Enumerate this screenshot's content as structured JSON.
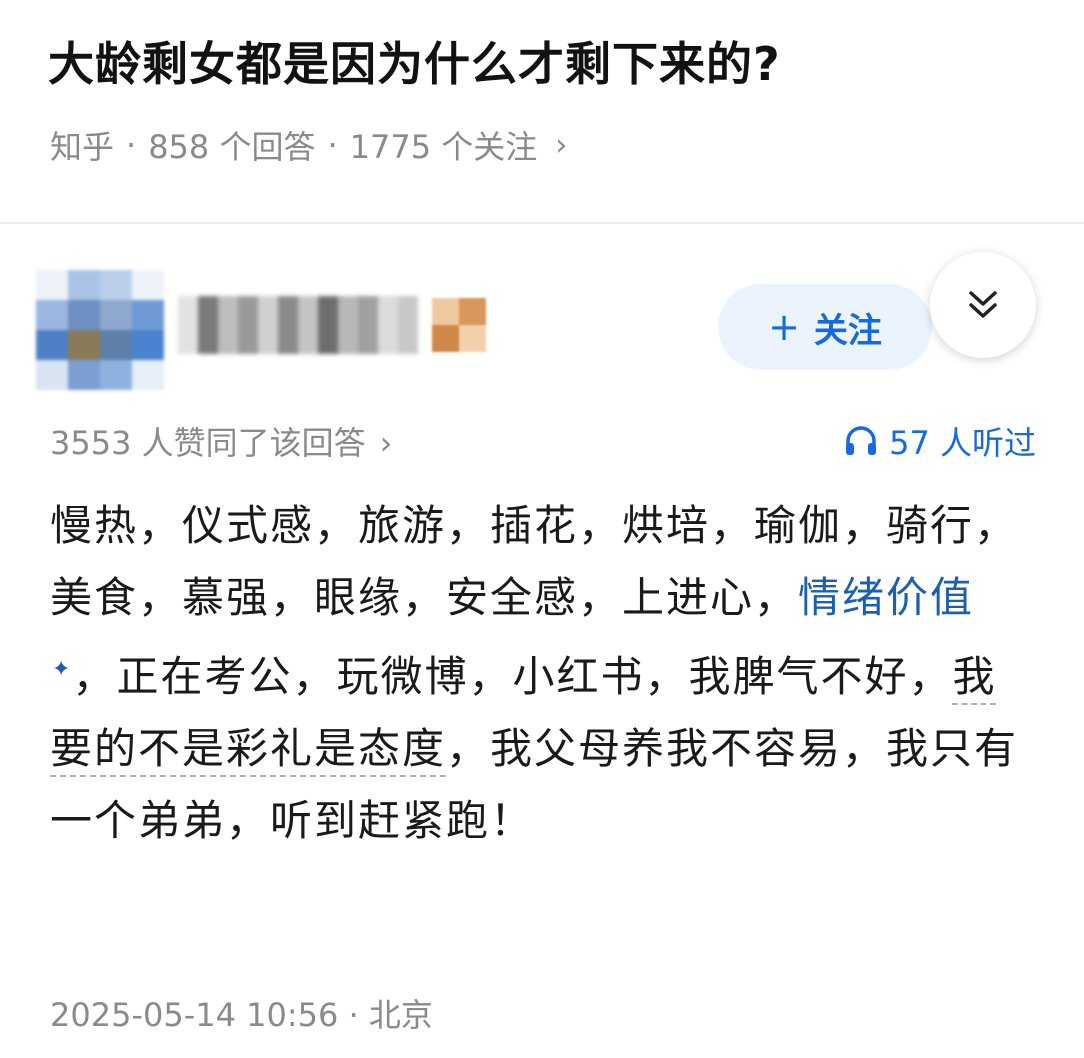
{
  "question": {
    "title": "大龄剩女都是因为什么才剩下来的?",
    "source": "知乎",
    "answers": "858 个回答",
    "followers": "1775 个关注",
    "separator": "·",
    "chevron": "›"
  },
  "author": {
    "follow_label": "关注",
    "follow_plus": "+",
    "collapse_icon": "double-chevron-down-icon"
  },
  "stats": {
    "upvote_text": "3553 人赞同了该回答",
    "upvote_chevron": "›",
    "listen_text": "57 人听过",
    "listen_icon": "headphones-icon"
  },
  "answer": {
    "part1": "慢热，仪式感，旅游，插花，烘培，瑜伽，骑行，美食，慕强，眼缘，安全感，上进心，",
    "link_text": "情绪价值",
    "link_mark": "✦",
    "part2": "，正在考公，玩微博，小红书，我脾气不好，",
    "underlined": "我要的不是彩礼是态度",
    "part3": "，我父母养我不容易，我只有一个弟弟，听到赶紧跑！"
  },
  "footer": {
    "timestamp": "2025-05-14 10:56",
    "separator": "·",
    "location": "北京"
  },
  "colors": {
    "accent": "#1769e0",
    "link": "#1a5fb4",
    "meta_gray": "#8a8a8a"
  }
}
